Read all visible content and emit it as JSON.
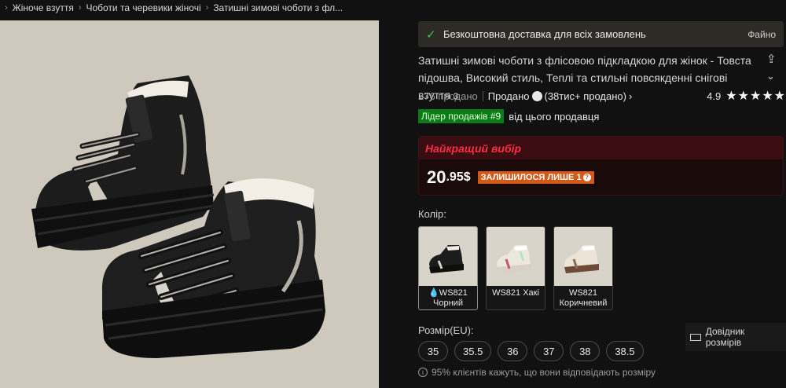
{
  "breadcrumb": [
    "Жіноче взуття",
    "Чоботи та черевики жіночі",
    "Затишні зимові чоботи з фл..."
  ],
  "shipping": {
    "text": "Безкоштовна доставка для всіх замовлень",
    "more": "Файно"
  },
  "product": {
    "title": "Затишні зимові чоботи з флісовою підкладкою для жінок - Товста підошва, Високий стиль, Теплі та стильні повсякденні снігові взуття з"
  },
  "stats": {
    "sold": "276 продано",
    "sold_by_prefix": "Продано",
    "sold_by_suffix": "(38тис+ продано)",
    "rating": "4.9",
    "stars": "★★★★★"
  },
  "bestseller": {
    "badge": "Лідер продажів #9",
    "text": "від цього продавця"
  },
  "deal": {
    "label": "Найкращий вибір",
    "price_int": "20",
    "price_dec": ".95",
    "currency": "$",
    "stock_badge": "ЗАЛИШИЛОСЯ ЛИШЕ 1"
  },
  "colors": {
    "label": "Колір:",
    "options": [
      {
        "line1": "💧WS821",
        "line2": "Чорний"
      },
      {
        "line1": "WS821 Хакі",
        "line2": ""
      },
      {
        "line1": "WS821",
        "line2": "Коричневий"
      }
    ]
  },
  "sizes": {
    "label": "Розмір(EU):",
    "guide": "Довідник розмірів",
    "options": [
      "35",
      "35.5",
      "36",
      "37",
      "38",
      "38.5"
    ],
    "fit_note": "95% клієнтів кажуть, що вони відповідають розміру"
  },
  "icons": {
    "chevron": "›",
    "check": "✓",
    "share": "⇪",
    "expand": "⌄",
    "info": "i",
    "question": "?"
  },
  "colors_theme": {
    "background": "#111111",
    "accent_red": "#ff2d43",
    "badge_green": "#0b7a17",
    "badge_orange": "#d25a19"
  }
}
